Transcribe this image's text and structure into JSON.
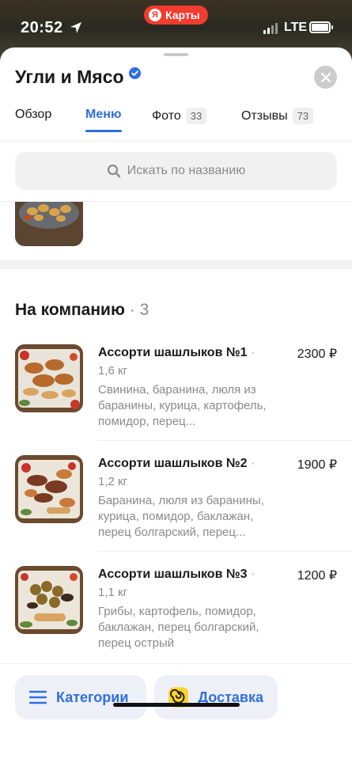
{
  "status_bar": {
    "time": "20:52",
    "network": "LTE",
    "brand": "Карты",
    "brand_letter": "Я"
  },
  "header": {
    "title": "Угли и Мясо"
  },
  "tabs": [
    {
      "label": "Обзор"
    },
    {
      "label": "Меню",
      "active": true
    },
    {
      "label": "Фото",
      "count": "33"
    },
    {
      "label": "Отзывы",
      "count": "73"
    }
  ],
  "search": {
    "placeholder": "Искать по названию"
  },
  "section": {
    "title": "На компанию",
    "count": "3",
    "separator": "·"
  },
  "items": [
    {
      "name": "Ассорти шашлыков №1",
      "weight": "1,6 кг",
      "price": "2300 ₽",
      "description": "Свинина, баранина, люля из баранины, курица, картофель, помидор, перец..."
    },
    {
      "name": "Ассорти шашлыков №2",
      "weight": "1,2 кг",
      "price": "1900 ₽",
      "description": "Баранина, люля из баранины, курица, помидор, баклажан, перец болгарский, перец..."
    },
    {
      "name": "Ассорти шашлыков №3",
      "weight": "1,1 кг",
      "price": "1200 ₽",
      "description": "Грибы, картофель, помидор, баклажан, перец болгарский, перец острый"
    }
  ],
  "bottom": {
    "categories_label": "Категории",
    "delivery_label": "Доставка"
  },
  "colors": {
    "accent": "#2f6fe0",
    "brand": "#f23c2f"
  }
}
